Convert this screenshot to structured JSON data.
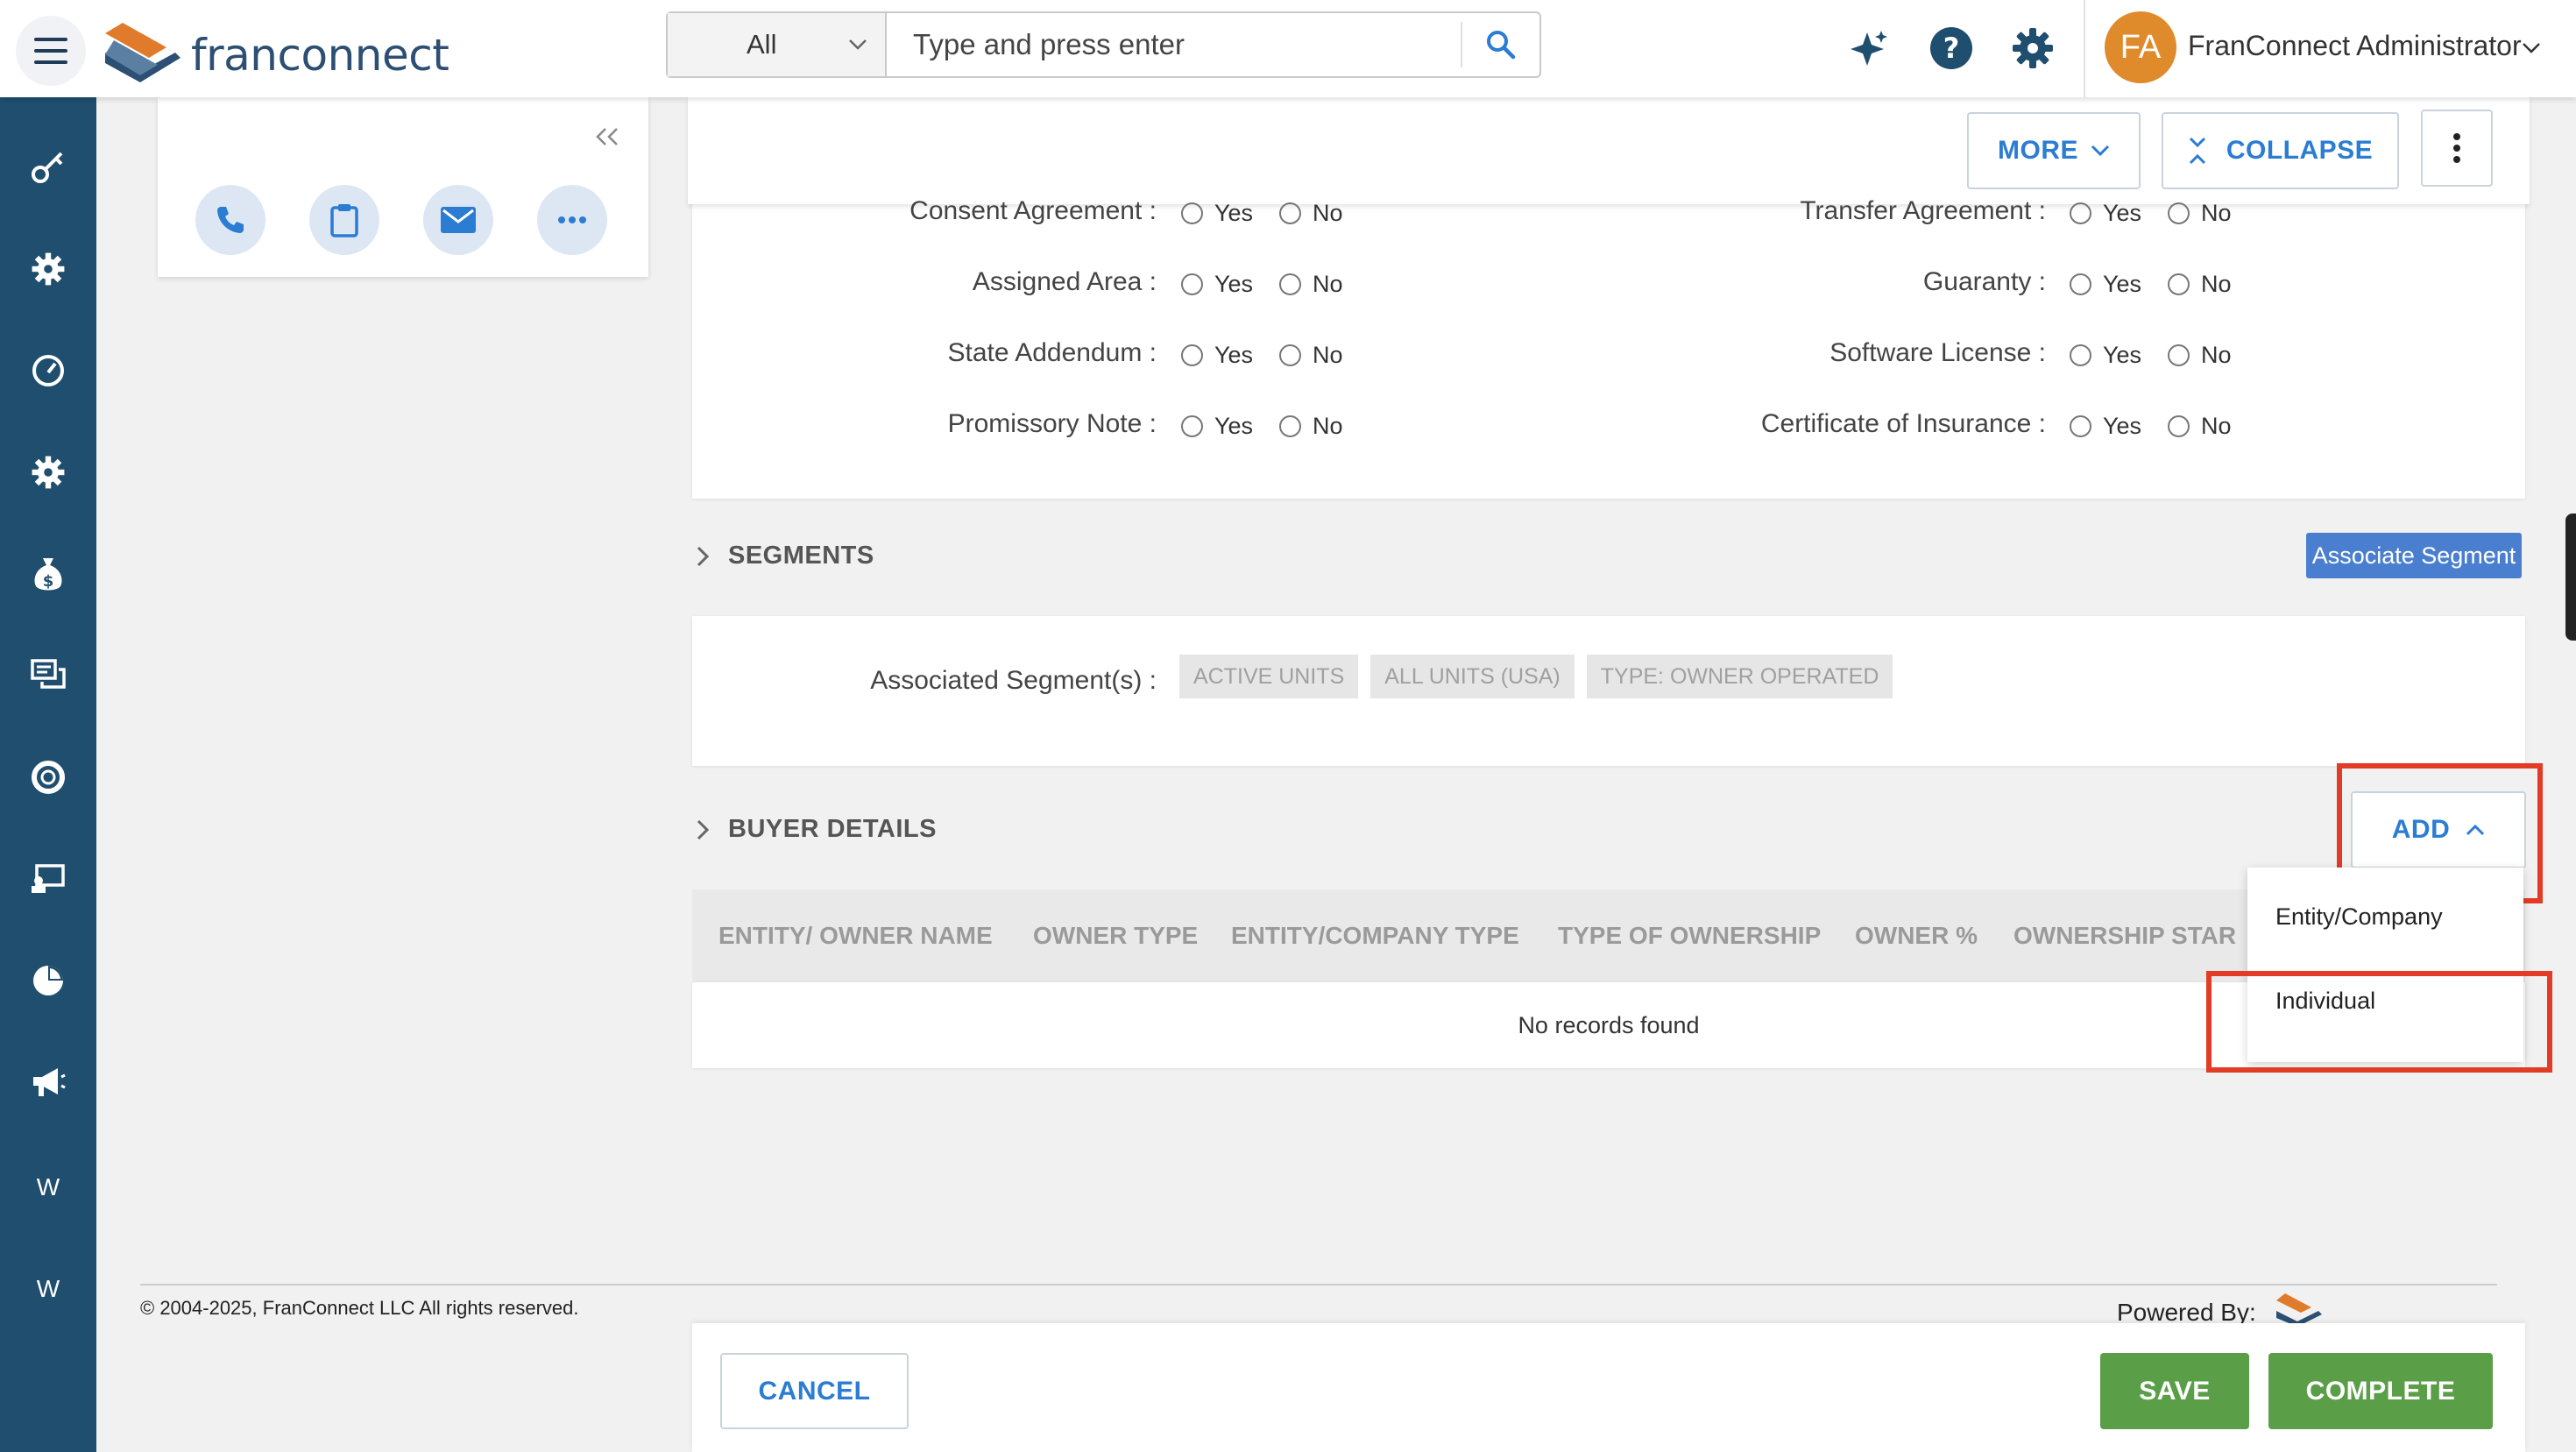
{
  "header": {
    "logo_text": "franconnect",
    "search": {
      "scope": "All",
      "placeholder": "Type and press enter"
    },
    "avatar_initials": "FA",
    "user_name": "FranConnect Administrator"
  },
  "sidebar": {
    "items": [
      {
        "icon": "key-icon"
      },
      {
        "icon": "gear-icon"
      },
      {
        "icon": "dashboard-icon"
      },
      {
        "icon": "gear-icon"
      },
      {
        "icon": "money-bag-icon"
      },
      {
        "icon": "chat-icon"
      },
      {
        "icon": "lifebuoy-icon"
      },
      {
        "icon": "training-icon"
      },
      {
        "icon": "pie-icon"
      },
      {
        "icon": "megaphone-icon"
      },
      {
        "icon": "letter-icon",
        "label": "W"
      },
      {
        "icon": "letter-icon",
        "label": "W"
      }
    ]
  },
  "toolbar": {
    "more_label": "MORE",
    "collapse_label": "COLLAPSE"
  },
  "agreements": {
    "yes": "Yes",
    "no": "No",
    "left": [
      "Consent Agreement :",
      "Assigned Area :",
      "State Addendum :",
      "Promissory Note :"
    ],
    "right": [
      "Transfer Agreement :",
      "Guaranty :",
      "Software License :",
      "Certificate of Insurance :"
    ]
  },
  "segments": {
    "title": "SEGMENTS",
    "associate_button": "Associate Segment",
    "label": "Associated Segment(s) :",
    "chips": [
      "ACTIVE UNITS",
      "ALL UNITS (USA)",
      "TYPE: OWNER OPERATED"
    ]
  },
  "buyer_details": {
    "title": "BUYER DETAILS",
    "add_button": "ADD",
    "columns": [
      "ENTITY/ OWNER NAME",
      "OWNER TYPE",
      "ENTITY/COMPANY TYPE",
      "TYPE OF OWNERSHIP",
      "OWNER %",
      "OWNERSHIP STAR"
    ],
    "empty_text": "No records found",
    "dropdown": [
      "Entity/Company",
      "Individual"
    ]
  },
  "footer": {
    "copyright": "© 2004-2025, FranConnect LLC All rights reserved.",
    "powered_by": "Powered By:"
  },
  "actions": {
    "cancel": "CANCEL",
    "save": "SAVE",
    "complete": "COMPLETE"
  },
  "colors": {
    "sidebar": "#1f4e6e",
    "accent": "#2b7cd3",
    "green": "#5b9e48",
    "highlight": "#e23b26"
  }
}
